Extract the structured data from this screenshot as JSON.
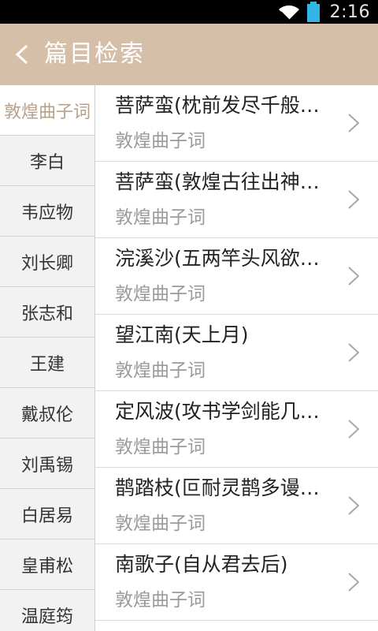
{
  "status": {
    "time": "2:16"
  },
  "header": {
    "title": "篇目检索"
  },
  "sidebar": {
    "items": [
      {
        "label": "敦煌曲子词"
      },
      {
        "label": "李白"
      },
      {
        "label": "韦应物"
      },
      {
        "label": "刘长卿"
      },
      {
        "label": "张志和"
      },
      {
        "label": "王建"
      },
      {
        "label": "戴叔伦"
      },
      {
        "label": "刘禹锡"
      },
      {
        "label": "白居易"
      },
      {
        "label": "皇甫松"
      },
      {
        "label": "温庭筠"
      }
    ]
  },
  "list": {
    "rows": [
      {
        "title": "菩萨蛮(枕前发尽千般…",
        "author": "敦煌曲子词"
      },
      {
        "title": "菩萨蛮(敦煌古往出神…",
        "author": "敦煌曲子词"
      },
      {
        "title": "浣溪沙(五两竿头风欲…",
        "author": "敦煌曲子词"
      },
      {
        "title": "望江南(天上月)",
        "author": "敦煌曲子词"
      },
      {
        "title": "定风波(攻书学剑能几…",
        "author": "敦煌曲子词"
      },
      {
        "title": "鹊踏枝(叵耐灵鹊多谩…",
        "author": "敦煌曲子词"
      },
      {
        "title": "南歌子(自从君去后)",
        "author": "敦煌曲子词"
      }
    ]
  }
}
